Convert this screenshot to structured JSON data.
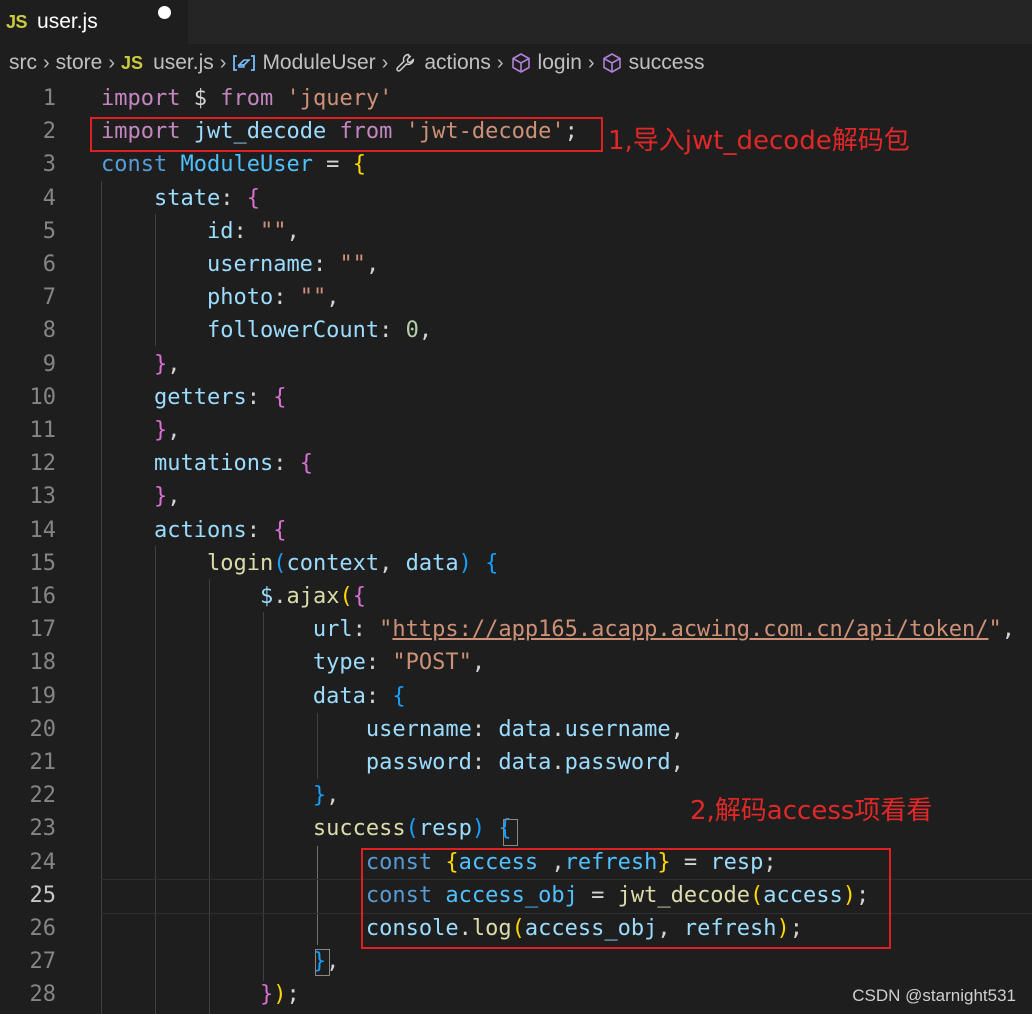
{
  "tab": {
    "icon": "JS",
    "filename": "user.js"
  },
  "breadcrumb": {
    "items": [
      "src",
      "store",
      "user.js",
      "ModuleUser",
      "actions",
      "login",
      "success"
    ],
    "js_icon": "JS"
  },
  "editor": {
    "active_line": 25,
    "lines": [
      {
        "n": "1",
        "tokens": [
          [
            "import",
            "kw2"
          ],
          [
            " $ ",
            "plain"
          ],
          [
            "from",
            "kw2"
          ],
          [
            " ",
            "plain"
          ],
          [
            "'jquery'",
            "str"
          ]
        ]
      },
      {
        "n": "2",
        "tokens": [
          [
            "import",
            "kw2"
          ],
          [
            " ",
            "plain"
          ],
          [
            "jwt_decode",
            "var"
          ],
          [
            " ",
            "plain"
          ],
          [
            "from",
            "kw2"
          ],
          [
            " ",
            "plain"
          ],
          [
            "'jwt-decode'",
            "str"
          ],
          [
            ";",
            "plain"
          ]
        ]
      },
      {
        "n": "3",
        "tokens": [
          [
            "const",
            "kw"
          ],
          [
            " ",
            "plain"
          ],
          [
            "ModuleUser",
            "tok"
          ],
          [
            " = ",
            "plain"
          ],
          [
            "{",
            "p1"
          ]
        ]
      },
      {
        "n": "4",
        "tokens": [
          [
            "    ",
            "plain"
          ],
          [
            "state",
            "var"
          ],
          [
            ": ",
            "plain"
          ],
          [
            "{",
            "p2"
          ]
        ]
      },
      {
        "n": "5",
        "tokens": [
          [
            "        ",
            "plain"
          ],
          [
            "id",
            "var"
          ],
          [
            ": ",
            "plain"
          ],
          [
            "\"\"",
            "str"
          ],
          [
            ",",
            "plain"
          ]
        ]
      },
      {
        "n": "6",
        "tokens": [
          [
            "        ",
            "plain"
          ],
          [
            "username",
            "var"
          ],
          [
            ": ",
            "plain"
          ],
          [
            "\"\"",
            "str"
          ],
          [
            ",",
            "plain"
          ]
        ]
      },
      {
        "n": "7",
        "tokens": [
          [
            "        ",
            "plain"
          ],
          [
            "photo",
            "var"
          ],
          [
            ": ",
            "plain"
          ],
          [
            "\"\"",
            "str"
          ],
          [
            ",",
            "plain"
          ]
        ]
      },
      {
        "n": "8",
        "tokens": [
          [
            "        ",
            "plain"
          ],
          [
            "followerCount",
            "var"
          ],
          [
            ": ",
            "plain"
          ],
          [
            "0",
            "num"
          ],
          [
            ",",
            "plain"
          ]
        ]
      },
      {
        "n": "9",
        "tokens": [
          [
            "    ",
            "plain"
          ],
          [
            "}",
            "p2"
          ],
          [
            ",",
            "plain"
          ]
        ]
      },
      {
        "n": "10",
        "tokens": [
          [
            "    ",
            "plain"
          ],
          [
            "getters",
            "var"
          ],
          [
            ": ",
            "plain"
          ],
          [
            "{",
            "p2"
          ]
        ]
      },
      {
        "n": "11",
        "tokens": [
          [
            "    ",
            "plain"
          ],
          [
            "}",
            "p2"
          ],
          [
            ",",
            "plain"
          ]
        ]
      },
      {
        "n": "12",
        "tokens": [
          [
            "    ",
            "plain"
          ],
          [
            "mutations",
            "var"
          ],
          [
            ": ",
            "plain"
          ],
          [
            "{",
            "p2"
          ]
        ]
      },
      {
        "n": "13",
        "tokens": [
          [
            "    ",
            "plain"
          ],
          [
            "}",
            "p2"
          ],
          [
            ",",
            "plain"
          ]
        ]
      },
      {
        "n": "14",
        "tokens": [
          [
            "    ",
            "plain"
          ],
          [
            "actions",
            "var"
          ],
          [
            ": ",
            "plain"
          ],
          [
            "{",
            "p2"
          ]
        ]
      },
      {
        "n": "15",
        "tokens": [
          [
            "        ",
            "plain"
          ],
          [
            "login",
            "fn"
          ],
          [
            "(",
            "p3"
          ],
          [
            "context",
            "var"
          ],
          [
            ", ",
            "plain"
          ],
          [
            "data",
            "var"
          ],
          [
            ")",
            "p3"
          ],
          [
            " ",
            "plain"
          ],
          [
            "{",
            "p3"
          ]
        ]
      },
      {
        "n": "16",
        "tokens": [
          [
            "            ",
            "plain"
          ],
          [
            "$",
            "var"
          ],
          [
            ".",
            "plain"
          ],
          [
            "ajax",
            "fn"
          ],
          [
            "(",
            "p1"
          ],
          [
            "{",
            "p2"
          ]
        ]
      },
      {
        "n": "17",
        "tokens": [
          [
            "                ",
            "plain"
          ],
          [
            "url",
            "var"
          ],
          [
            ": ",
            "plain"
          ],
          [
            "\"",
            "str"
          ],
          [
            "https://app165.acapp.acwing.com.cn/api/token/",
            "url"
          ],
          [
            "\"",
            "str"
          ],
          [
            ",",
            "plain"
          ]
        ]
      },
      {
        "n": "18",
        "tokens": [
          [
            "                ",
            "plain"
          ],
          [
            "type",
            "var"
          ],
          [
            ": ",
            "plain"
          ],
          [
            "\"POST\"",
            "str"
          ],
          [
            ",",
            "plain"
          ]
        ]
      },
      {
        "n": "19",
        "tokens": [
          [
            "                ",
            "plain"
          ],
          [
            "data",
            "var"
          ],
          [
            ": ",
            "plain"
          ],
          [
            "{",
            "p3"
          ]
        ]
      },
      {
        "n": "20",
        "tokens": [
          [
            "                    ",
            "plain"
          ],
          [
            "username",
            "var"
          ],
          [
            ": ",
            "plain"
          ],
          [
            "data",
            "var"
          ],
          [
            ".",
            "plain"
          ],
          [
            "username",
            "var"
          ],
          [
            ",",
            "plain"
          ]
        ]
      },
      {
        "n": "21",
        "tokens": [
          [
            "                    ",
            "plain"
          ],
          [
            "password",
            "var"
          ],
          [
            ": ",
            "plain"
          ],
          [
            "data",
            "var"
          ],
          [
            ".",
            "plain"
          ],
          [
            "password",
            "var"
          ],
          [
            ",",
            "plain"
          ]
        ]
      },
      {
        "n": "22",
        "tokens": [
          [
            "                ",
            "plain"
          ],
          [
            "}",
            "p3"
          ],
          [
            ",",
            "plain"
          ]
        ]
      },
      {
        "n": "23",
        "tokens": [
          [
            "                ",
            "plain"
          ],
          [
            "success",
            "fn"
          ],
          [
            "(",
            "p3"
          ],
          [
            "resp",
            "var"
          ],
          [
            ")",
            "p3"
          ],
          [
            " ",
            "plain"
          ],
          [
            "{",
            "p3"
          ]
        ]
      },
      {
        "n": "24",
        "tokens": [
          [
            "                    ",
            "plain"
          ],
          [
            "const",
            "kw"
          ],
          [
            " ",
            "plain"
          ],
          [
            "{",
            "p1"
          ],
          [
            "access",
            "tok"
          ],
          [
            " ,",
            "plain"
          ],
          [
            "refresh",
            "tok"
          ],
          [
            "}",
            "p1"
          ],
          [
            " = ",
            "plain"
          ],
          [
            "resp",
            "var"
          ],
          [
            ";",
            "plain"
          ]
        ]
      },
      {
        "n": "25",
        "tokens": [
          [
            "                    ",
            "plain"
          ],
          [
            "const",
            "kw"
          ],
          [
            " ",
            "plain"
          ],
          [
            "access_obj",
            "tok"
          ],
          [
            " = ",
            "plain"
          ],
          [
            "jwt_decode",
            "fn"
          ],
          [
            "(",
            "p1"
          ],
          [
            "access",
            "var"
          ],
          [
            ")",
            "p1"
          ],
          [
            ";",
            "plain"
          ]
        ]
      },
      {
        "n": "26",
        "tokens": [
          [
            "                    ",
            "plain"
          ],
          [
            "console",
            "var"
          ],
          [
            ".",
            "plain"
          ],
          [
            "log",
            "fn"
          ],
          [
            "(",
            "p1"
          ],
          [
            "access_obj",
            "var"
          ],
          [
            ", ",
            "plain"
          ],
          [
            "refresh",
            "var"
          ],
          [
            ")",
            "p1"
          ],
          [
            ";",
            "plain"
          ]
        ]
      },
      {
        "n": "27",
        "tokens": [
          [
            "                ",
            "plain"
          ],
          [
            "}",
            "p3"
          ],
          [
            ",",
            "plain"
          ]
        ]
      },
      {
        "n": "28",
        "tokens": [
          [
            "            ",
            "plain"
          ],
          [
            "}",
            "p2"
          ],
          [
            ")",
            "p1"
          ],
          [
            ";",
            "plain"
          ]
        ]
      }
    ]
  },
  "annotations": {
    "first": "1,导入jwt_decode解码包",
    "second": "2,解码access项看看"
  },
  "watermark": "CSDN @starnight531"
}
